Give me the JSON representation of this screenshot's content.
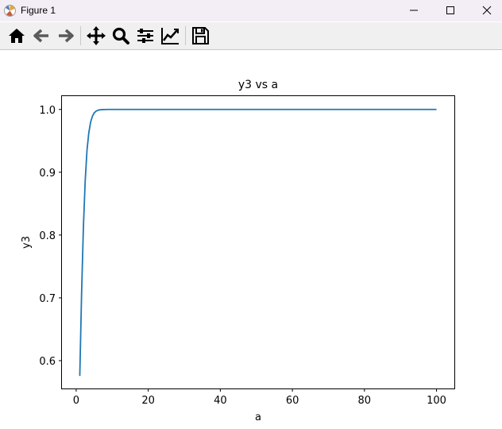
{
  "window": {
    "title": "Figure 1",
    "buttons": [
      "minimize",
      "maximize",
      "close"
    ]
  },
  "toolbar": {
    "tools": [
      {
        "name": "home",
        "icon": "home-icon"
      },
      {
        "name": "back",
        "icon": "back-arrow-icon"
      },
      {
        "name": "forward",
        "icon": "forward-arrow-icon"
      },
      {
        "name": "pan",
        "icon": "pan-move-icon"
      },
      {
        "name": "zoom",
        "icon": "zoom-magnifier-icon"
      },
      {
        "name": "configure-subplots",
        "icon": "sliders-icon"
      },
      {
        "name": "edit-axis",
        "icon": "line-chart-icon"
      },
      {
        "name": "save",
        "icon": "floppy-disk-icon"
      }
    ]
  },
  "chart_data": {
    "type": "line",
    "title": "y3 vs a",
    "xlabel": "a",
    "ylabel": "y3",
    "xlim": [
      -3.95,
      104.95
    ],
    "ylim": [
      0.5557,
      1.0212
    ],
    "xticks": [
      "0",
      "20",
      "40",
      "60",
      "80",
      "100"
    ],
    "yticks": [
      "0.6",
      "0.7",
      "0.8",
      "0.9",
      "1.0"
    ],
    "grid": false,
    "line_color": "#1f77b4",
    "series": [
      {
        "x": [
          1,
          1.5,
          2,
          2.5,
          3,
          3.5,
          4,
          4.5,
          5,
          5.5,
          6,
          6.5,
          7,
          7.5,
          8,
          8.5,
          9,
          10,
          12,
          15,
          20,
          30,
          40,
          50,
          60,
          70,
          80,
          90,
          100
        ],
        "y": [
          0.5757,
          0.7071,
          0.8123,
          0.8862,
          0.9352,
          0.9628,
          0.9796,
          0.9892,
          0.9945,
          0.9972,
          0.9986,
          0.9993,
          0.9997,
          0.9998,
          0.9999,
          1.0,
          1.0,
          1.0,
          1.0,
          1.0,
          1.0,
          1.0,
          1.0,
          1.0,
          1.0,
          1.0,
          1.0,
          1.0,
          1.0
        ]
      }
    ]
  }
}
